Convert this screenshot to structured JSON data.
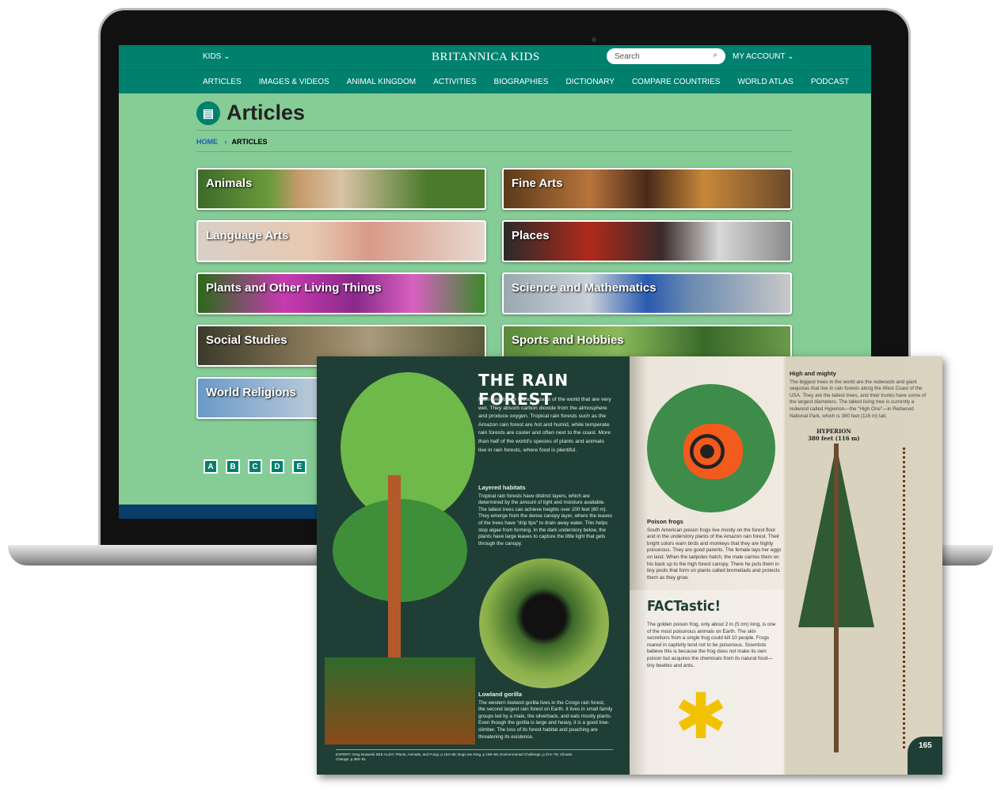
{
  "site": {
    "brand": "BRITANNICA KIDS",
    "kids_menu": "KIDS",
    "search_placeholder": "Search",
    "account": "MY ACCOUNT",
    "nav": [
      "ARTICLES",
      "IMAGES & VIDEOS",
      "ANIMAL KINGDOM",
      "ACTIVITIES",
      "BIOGRAPHIES",
      "DICTIONARY",
      "COMPARE COUNTRIES",
      "WORLD ATLAS",
      "PODCAST"
    ],
    "page_title": "Articles",
    "breadcrumb": {
      "home": "HOME",
      "current": "ARTICLES"
    },
    "categories": [
      "Animals",
      "Fine Arts",
      "Language Arts",
      "Places",
      "Plants and Other Living Things",
      "Science and Mathematics",
      "Social Studies",
      "Sports and Hobbies",
      "World Religions"
    ],
    "letters": [
      "A",
      "B",
      "C",
      "D",
      "E"
    ],
    "colors": {
      "header": "#00806f",
      "body": "#86cc96"
    }
  },
  "book": {
    "title": "THE RAIN FOREST",
    "intro": "Rain forests are found in parts of the world that are very wet. They absorb carbon dioxide from the atmosphere and produce oxygen. Tropical rain forests such as the Amazon rain forest are hot and humid, while temperate rain forests are cooler and often next to the coast. More than half of the world's species of plants and animals live in rain forests, where food is plentiful.",
    "layered_title": "Layered habitats",
    "layered_text": "Tropical rain forests have distinct layers, which are determined by the amount of light and moisture available. The tallest trees can achieve heights over 200 feet (60 m). They emerge from the dense canopy layer, where the leaves of the trees have \"drip tips\" to drain away water. This helps stop algae from forming. In the dark understory below, the plants have large leaves to capture the little light that gets through the canopy.",
    "gorilla_title": "Lowland gorilla",
    "gorilla_text": "The western lowland gorilla lives in the Congo rain forest, the second largest rain forest on Earth. It lives in small family groups led by a male, the silverback, and eats mostly plants. Even though the gorilla is large and heavy, it is a good tree-climber. The loss of its forest habitat and poaching are threatening its existence.",
    "footer": "EXPERT: Greg Nowacki SEE ALSO: Plants, Animals, and Fungi, p.164–65; Bugs are King, p.168–69; Environmental Challenge, p.374–75; Climate Change, p.380–81",
    "frogs_title": "Poison frogs",
    "frogs_text": "South American poison frogs live mostly on the forest floor and in the understory plants of the Amazon rain forest. Their bright colors warn birds and monkeys that they are highly poisonous. They are good parents. The female lays her eggs on land. When the tadpoles hatch, the male carries them on his back up to the high forest canopy. There he puts them in tiny pools that form on plants called bromeliads and protects them as they grow.",
    "fact_title": "FACTastic!",
    "fact_text": "The golden poison frog, only about 2 in (5 cm) long, is one of the most poisonous animals on Earth. The skin secretions from a single frog could kill 10 people. Frogs reared in captivity tend not to be poisonous. Scientists believe this is because the frog does not make its own poison but acquires the chemicals from its natural food—tiny beetles and ants.",
    "high_title": "High and mighty",
    "high_text": "The biggest trees in the world are the redwoods and giant sequoias that live in rain forests along the West Coast of the USA. They are the tallest trees, and their trunks have some of the largest diameters. The tallest living tree is currently a redwood called Hyperion—the \"High One\"—in Redwood National Park, which is 380 feet (116 m) tall.",
    "hyperion": "HYPERION",
    "hyperion_height": "380 feet (116 m)",
    "page_number": "165"
  }
}
